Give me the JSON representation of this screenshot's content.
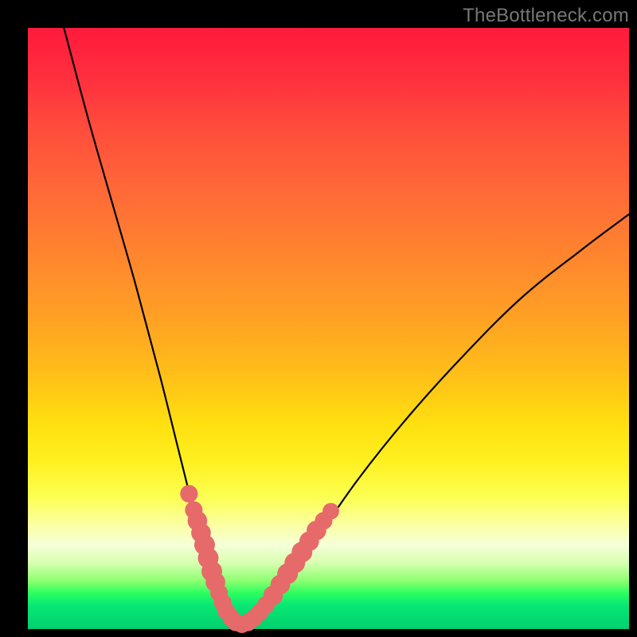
{
  "watermark": "TheBottleneck.com",
  "chart_data": {
    "type": "line",
    "title": "",
    "xlabel": "",
    "ylabel": "",
    "xlim": [
      0,
      100
    ],
    "ylim": [
      0,
      100
    ],
    "series": [
      {
        "name": "bottleneck-curve",
        "x": [
          6,
          10,
          14,
          18,
          22,
          25,
          27,
          28.5,
          30,
          31.5,
          33,
          34.5,
          36,
          38,
          40,
          43,
          48,
          55,
          63,
          72,
          82,
          92,
          100
        ],
        "values": [
          100,
          85,
          71,
          57,
          42,
          30,
          22,
          16,
          10,
          5.5,
          2.5,
          1,
          1,
          2,
          4.5,
          8,
          15,
          25,
          35,
          45,
          55,
          63,
          69
        ]
      }
    ],
    "markers": {
      "name": "highlight-dots",
      "color": "#e66a6a",
      "points": [
        {
          "x": 26.8,
          "y": 22.5,
          "r": 1.1
        },
        {
          "x": 27.6,
          "y": 19.8,
          "r": 1.1
        },
        {
          "x": 28.2,
          "y": 18.0,
          "r": 1.3
        },
        {
          "x": 28.8,
          "y": 16.0,
          "r": 1.3
        },
        {
          "x": 29.4,
          "y": 14.0,
          "r": 1.4
        },
        {
          "x": 30.0,
          "y": 11.8,
          "r": 1.4
        },
        {
          "x": 30.6,
          "y": 9.6,
          "r": 1.4
        },
        {
          "x": 31.2,
          "y": 7.8,
          "r": 1.3
        },
        {
          "x": 31.8,
          "y": 6.0,
          "r": 1.1
        },
        {
          "x": 32.4,
          "y": 4.4,
          "r": 1.1
        },
        {
          "x": 33.0,
          "y": 3.0,
          "r": 1.1
        },
        {
          "x": 33.8,
          "y": 1.9,
          "r": 1.1
        },
        {
          "x": 34.6,
          "y": 1.1,
          "r": 1.1
        },
        {
          "x": 35.6,
          "y": 0.8,
          "r": 1.1
        },
        {
          "x": 36.6,
          "y": 1.1,
          "r": 1.1
        },
        {
          "x": 37.6,
          "y": 1.8,
          "r": 1.1
        },
        {
          "x": 38.6,
          "y": 2.8,
          "r": 1.1
        },
        {
          "x": 39.6,
          "y": 4.0,
          "r": 1.1
        },
        {
          "x": 40.8,
          "y": 5.6,
          "r": 1.3
        },
        {
          "x": 42.0,
          "y": 7.4,
          "r": 1.3
        },
        {
          "x": 43.2,
          "y": 9.2,
          "r": 1.4
        },
        {
          "x": 44.4,
          "y": 11.0,
          "r": 1.4
        },
        {
          "x": 45.6,
          "y": 12.8,
          "r": 1.4
        },
        {
          "x": 46.8,
          "y": 14.6,
          "r": 1.3
        },
        {
          "x": 48.0,
          "y": 16.4,
          "r": 1.3
        },
        {
          "x": 49.2,
          "y": 18.0,
          "r": 1.1
        },
        {
          "x": 50.4,
          "y": 19.6,
          "r": 1.0
        }
      ]
    }
  }
}
